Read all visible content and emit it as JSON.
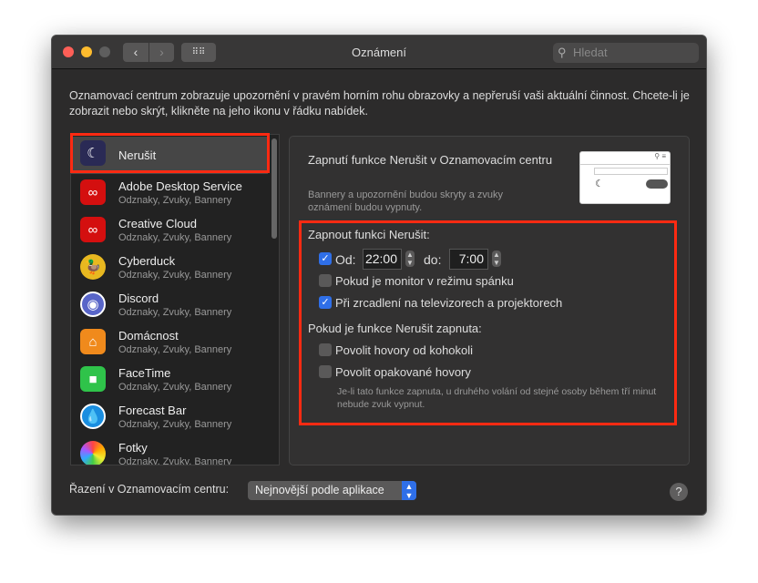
{
  "window": {
    "title": "Oznámení",
    "search_placeholder": "Hledat"
  },
  "intro": "Oznamovací centrum zobrazuje upozornění v pravém horním rohu obrazovky a nepřeruší vaši aktuální činnost. Chcete-li je zobrazit nebo skrýt, klikněte na jeho ikonu v řádku nabídek.",
  "apps": [
    {
      "name": "Nerušit",
      "sub": "",
      "icon": "moon-icon",
      "color": "#2a2a55"
    },
    {
      "name": "Adobe Desktop Service",
      "sub": "Odznaky, Zvuky, Bannery",
      "icon": "creative-cloud-icon",
      "color": "#d40f0f"
    },
    {
      "name": "Creative Cloud",
      "sub": "Odznaky, Zvuky, Bannery",
      "icon": "creative-cloud-icon",
      "color": "#d40f0f"
    },
    {
      "name": "Cyberduck",
      "sub": "Odznaky, Zvuky, Bannery",
      "icon": "duck-icon",
      "color": "#e8b820"
    },
    {
      "name": "Discord",
      "sub": "Odznaky, Zvuky, Bannery",
      "icon": "discord-icon",
      "color": "#5865c8"
    },
    {
      "name": "Domácnost",
      "sub": "Odznaky, Zvuky, Bannery",
      "icon": "home-icon",
      "color": "#f08a1c"
    },
    {
      "name": "FaceTime",
      "sub": "Odznaky, Zvuky, Bannery",
      "icon": "facetime-icon",
      "color": "#2fc34a"
    },
    {
      "name": "Forecast Bar",
      "sub": "Odznaky, Zvuky, Bannery",
      "icon": "drop-icon",
      "color": "#1a8ee0"
    },
    {
      "name": "Fotky",
      "sub": "Odznaky, Zvuky, Bannery",
      "icon": "photos-icon",
      "color": "#eeeeee"
    }
  ],
  "panel": {
    "title": "Zapnutí funkce Nerušit v Oznamovacím centru",
    "desc": "Bannery a upozornění budou skryty a zvuky oznámení budou vypnuty.",
    "section1": "Zapnout funkci Nerušit:",
    "from_label": "Od:",
    "from_value": "22:00",
    "from_checked": true,
    "to_label": "do:",
    "to_value": "7:00",
    "sleep_label": "Pokud je monitor v režimu spánku",
    "sleep_checked": false,
    "mirror_label": "Při zrcadlení na televizorech a projektorech",
    "mirror_checked": true,
    "section2": "Pokud je funkce Nerušit zapnuta:",
    "calls_label": "Povolit hovory od kohokoli",
    "calls_checked": false,
    "repeat_label": "Povolit opakované hovory",
    "repeat_checked": false,
    "note": "Je-li tato funkce zapnuta, u druhého volání od stejné osoby během tří minut nebude zvuk vypnut."
  },
  "bottom": {
    "sort_label": "Řazení v Oznamovacím centru:",
    "sort_value": "Nejnovější podle aplikace",
    "help": "?"
  },
  "accent": "#ff2a12"
}
